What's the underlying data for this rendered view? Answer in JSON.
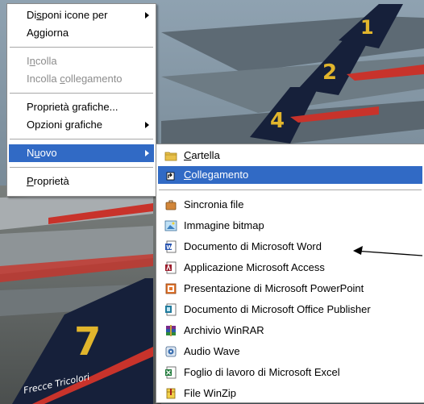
{
  "main_menu": {
    "items": [
      {
        "pre": "Di",
        "ul": "s",
        "post": "poni icone per",
        "submenu": true,
        "disabled": false
      },
      {
        "pre": "A",
        "ul": "g",
        "post": "giorna",
        "submenu": false,
        "disabled": false
      },
      {
        "pre": "I",
        "ul": "n",
        "post": "colla",
        "submenu": false,
        "disabled": true
      },
      {
        "pre": "Incolla ",
        "ul": "c",
        "post": "ollegamento",
        "submenu": false,
        "disabled": true
      },
      {
        "pre": "Proprietà grafiche...",
        "ul": "",
        "post": "",
        "submenu": false,
        "disabled": false
      },
      {
        "pre": "Opzioni grafiche",
        "ul": "",
        "post": "",
        "submenu": true,
        "disabled": false
      },
      {
        "pre": "N",
        "ul": "u",
        "post": "ovo",
        "submenu": true,
        "disabled": false
      },
      {
        "pre": "",
        "ul": "P",
        "post": "roprietà",
        "submenu": false,
        "disabled": false
      }
    ]
  },
  "sub_menu": {
    "items": [
      {
        "pre": "",
        "ul": "C",
        "post": "artella",
        "icon": "folder-icon"
      },
      {
        "pre": "",
        "ul": "C",
        "post": "ollegamento",
        "icon": "shortcut-icon"
      },
      {
        "pre": "Sincronia file",
        "ul": "",
        "post": "",
        "icon": "briefcase-icon"
      },
      {
        "pre": "Immagine bitmap",
        "ul": "",
        "post": "",
        "icon": "bitmap-icon"
      },
      {
        "pre": "Documento di Microsoft Word",
        "ul": "",
        "post": "",
        "icon": "word-icon"
      },
      {
        "pre": "Applicazione Microsoft Access",
        "ul": "",
        "post": "",
        "icon": "access-icon"
      },
      {
        "pre": "Presentazione di Microsoft PowerPoint",
        "ul": "",
        "post": "",
        "icon": "powerpoint-icon"
      },
      {
        "pre": "Documento di Microsoft Office Publisher",
        "ul": "",
        "post": "",
        "icon": "publisher-icon"
      },
      {
        "pre": "Archivio WinRAR",
        "ul": "",
        "post": "",
        "icon": "winrar-icon"
      },
      {
        "pre": "Audio Wave",
        "ul": "",
        "post": "",
        "icon": "wave-audio-icon"
      },
      {
        "pre": "Foglio di lavoro di Microsoft Excel",
        "ul": "",
        "post": "",
        "icon": "excel-icon"
      },
      {
        "pre": "File WinZip",
        "ul": "",
        "post": "",
        "icon": "winzip-icon"
      }
    ]
  },
  "wallpaper": {
    "tail_numbers": [
      "1",
      "2",
      "4",
      "7"
    ],
    "tail_text": "Frecce Tricolori"
  },
  "colors": {
    "highlight": "#316ac5",
    "sky": "#7f93a3",
    "tail_navy": "#16203a",
    "tail_yellow": "#e1b52c"
  }
}
